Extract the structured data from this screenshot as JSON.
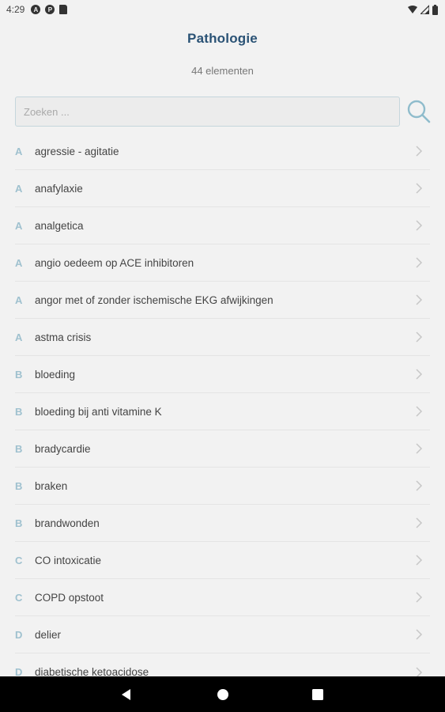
{
  "status_bar": {
    "time": "4:29",
    "left_icons": [
      "A",
      "P"
    ],
    "right_icons": [
      "wifi-icon",
      "signal-icon",
      "battery-icon"
    ]
  },
  "header": {
    "title": "Pathologie",
    "count": "44 elementen"
  },
  "search": {
    "placeholder": "Zoeken ...",
    "value": ""
  },
  "colors": {
    "title": "#2a5275",
    "letter": "#9fc1cf",
    "search_icon": "#8fbccc",
    "chevron": "#c7c7c7"
  },
  "items": [
    {
      "letter": "A",
      "label": "agressie - agitatie"
    },
    {
      "letter": "A",
      "label": "anafylaxie"
    },
    {
      "letter": "A",
      "label": "analgetica"
    },
    {
      "letter": "A",
      "label": "angio oedeem op ACE inhibitoren"
    },
    {
      "letter": "A",
      "label": "angor met of zonder ischemische EKG afwijkingen"
    },
    {
      "letter": "A",
      "label": "astma crisis"
    },
    {
      "letter": "B",
      "label": "bloeding"
    },
    {
      "letter": "B",
      "label": "bloeding bij anti vitamine K"
    },
    {
      "letter": "B",
      "label": "bradycardie"
    },
    {
      "letter": "B",
      "label": "braken"
    },
    {
      "letter": "B",
      "label": "brandwonden"
    },
    {
      "letter": "C",
      "label": "CO intoxicatie"
    },
    {
      "letter": "C",
      "label": "COPD opstoot"
    },
    {
      "letter": "D",
      "label": "delier"
    },
    {
      "letter": "D",
      "label": "diabetische ketoacidose"
    }
  ],
  "nav_bar": {
    "buttons": [
      "back-icon",
      "home-icon",
      "recents-icon"
    ]
  }
}
